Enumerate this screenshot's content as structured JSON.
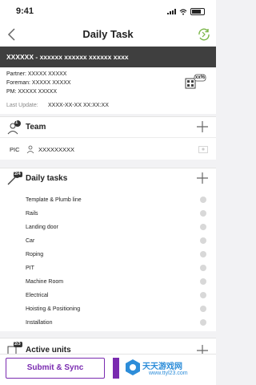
{
  "status_bar": {
    "time": "9:41"
  },
  "nav": {
    "title": "Daily Task"
  },
  "project": {
    "code": "XXXXXX - xxxxxx xxxxxx xxxxxx xxxx"
  },
  "info": {
    "partner": "Partner: XXXXX XXXXX",
    "foreman": "Foreman: XXXXX XXXXX",
    "pm": "PM: XXXXX XXXXX",
    "last_update_label": "Last Update:",
    "last_update_value": "XXXX-XX-XX XX:XX:XX",
    "badge": "xx%"
  },
  "team": {
    "title": "Team",
    "count": "1",
    "pic_label": "PIC",
    "pic_name": "XXXXXXXXX"
  },
  "daily_tasks": {
    "title": "Daily tasks",
    "count": "2/4",
    "items": [
      "Template & Plumb line",
      "Rails",
      "Landing door",
      "Car",
      "Roping",
      "PIT",
      "Machine Room",
      "Electrical",
      "Hoisting & Positioning",
      "Installation"
    ]
  },
  "active_units": {
    "title": "Active units",
    "count": "2/3"
  },
  "bottom": {
    "submit_label": "Submit & Sync"
  },
  "watermark": {
    "text": "天天游戏网",
    "url": "www.ttyl23.com"
  },
  "colors": {
    "accent": "#7a2bb0",
    "header_bg": "#3f3f3f",
    "sync_icon": "#7ab648"
  }
}
